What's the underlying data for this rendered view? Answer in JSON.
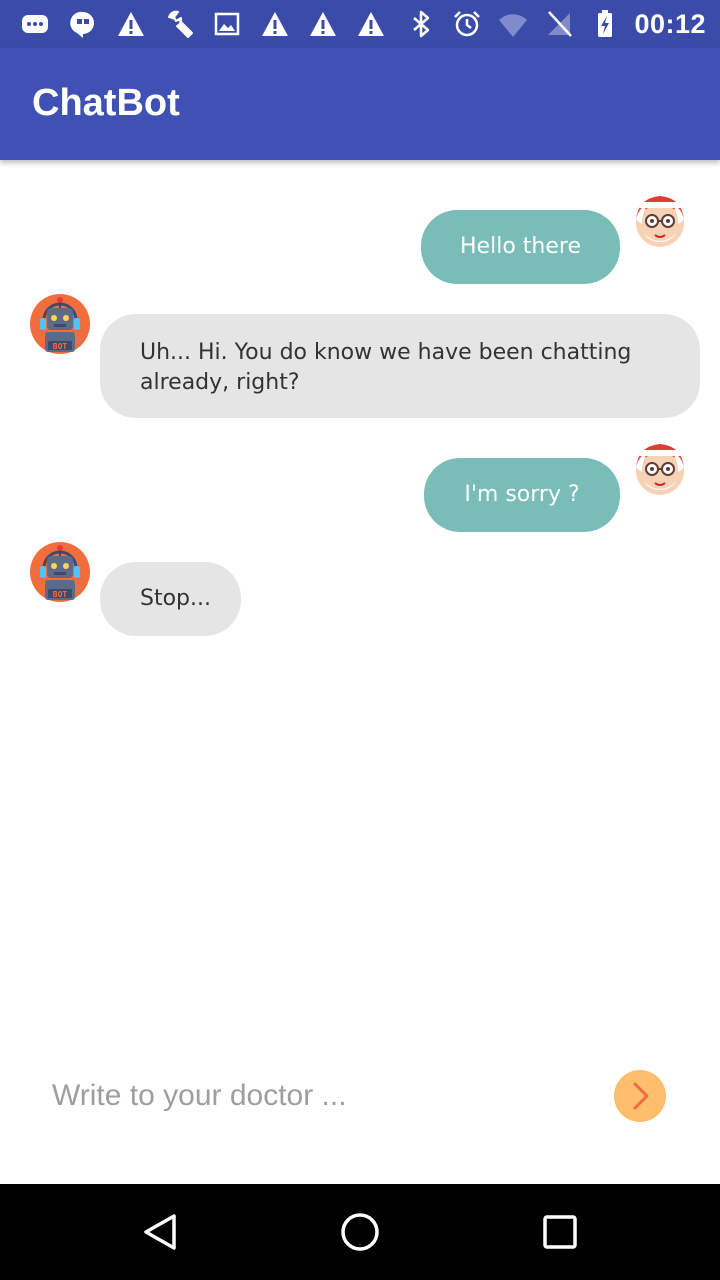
{
  "status_bar": {
    "time": "00:12",
    "left_icons": [
      "message-icon",
      "hangouts-icon",
      "warning-icon",
      "wrench-icon",
      "image-icon",
      "warning-icon",
      "warning-icon",
      "warning-icon"
    ],
    "right_icons": [
      "bluetooth-icon",
      "alarm-icon",
      "wifi-icon",
      "no-sim-icon",
      "battery-charging-icon"
    ]
  },
  "app_bar": {
    "title": "ChatBot"
  },
  "messages": [
    {
      "sender": "user",
      "text": "Hello there",
      "avatar": "grandma-avatar"
    },
    {
      "sender": "bot",
      "text": "Uh... Hi. You do know we have been chatting already, right?",
      "avatar": "robot-avatar"
    },
    {
      "sender": "user",
      "text": "I'm sorry ?",
      "avatar": "grandma-avatar"
    },
    {
      "sender": "bot",
      "text": "Stop...",
      "avatar": "robot-avatar"
    }
  ],
  "composer": {
    "placeholder": "Write to your doctor ...",
    "value": "",
    "send_icon": "chevron-right-icon"
  },
  "nav_bar": {
    "buttons": [
      "back-icon",
      "home-icon",
      "recents-icon"
    ]
  },
  "colors": {
    "status_bar": "#3a4ca8",
    "app_bar": "#3f51b5",
    "user_bubble": "#79bcb8",
    "bot_bubble": "#e5e5e5",
    "send_button": "#ffbe6e",
    "send_chevron": "#f26d3d"
  }
}
